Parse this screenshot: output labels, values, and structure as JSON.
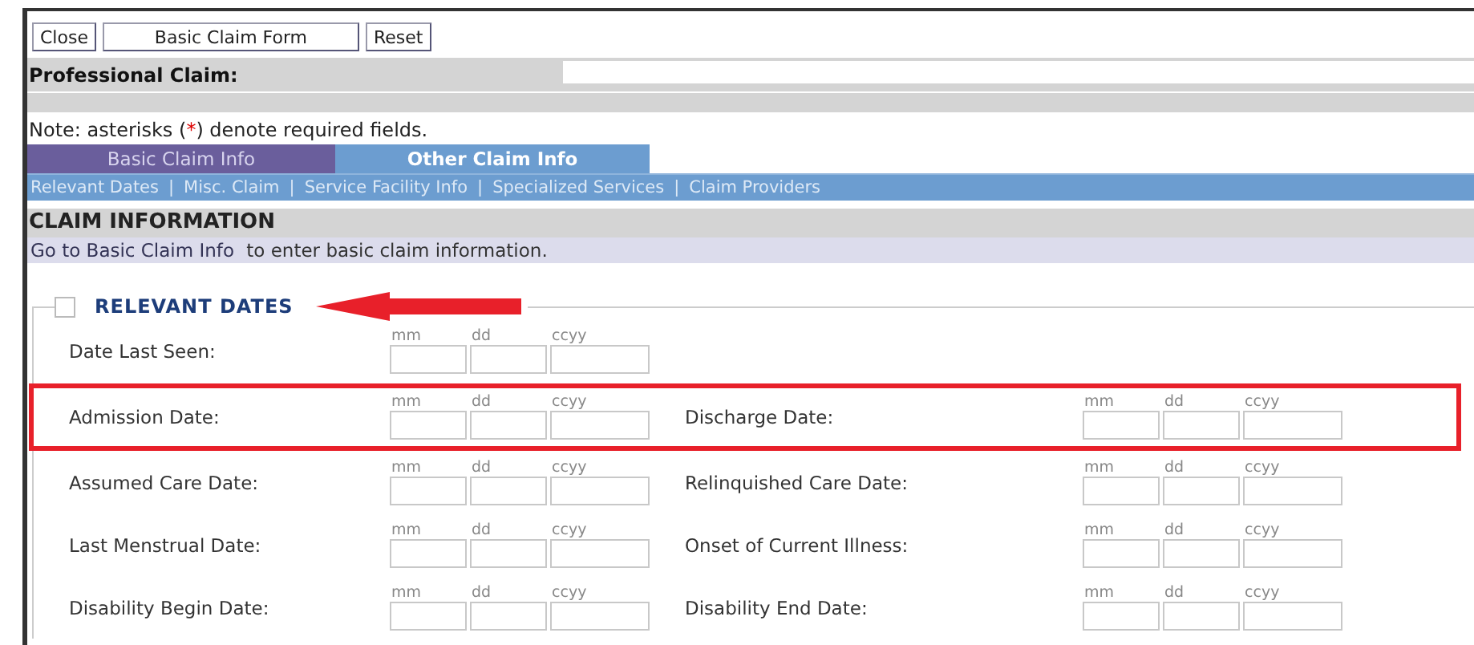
{
  "toolbar": {
    "buttons": [
      "Close",
      "Basic Claim Form",
      "Reset"
    ]
  },
  "header": {
    "title": "Professional Claim:"
  },
  "note": [
    {
      "text": "Note: asterisks (",
      "kind": "plain"
    },
    {
      "text": "*",
      "kind": "required"
    },
    {
      "text": ") denote required fields.",
      "kind": "plain"
    }
  ],
  "tabs": [
    {
      "label": "Basic Claim Info",
      "selected": false
    },
    {
      "label": "Other Claim Info",
      "selected": true
    }
  ],
  "subnav": {
    "separator": "|",
    "links": [
      "Relevant Dates",
      "Misc. Claim",
      "Service Facility Info",
      "Specialized Services",
      "Claim Providers"
    ]
  },
  "section": {
    "title": "CLAIM INFORMATION",
    "link": "Go to Basic Claim Info",
    "text": "to enter basic claim information."
  },
  "fieldset": {
    "title": "RELEVANT DATES",
    "checked": false,
    "pointed": true,
    "rows": [
      {
        "highlighted": false,
        "fields": [
          {
            "label": "Date Last Seen:",
            "hints": [
              "mm",
              "dd",
              "ccyy"
            ]
          }
        ]
      },
      {
        "highlighted": true,
        "fields": [
          {
            "label": "Admission Date:",
            "hints": [
              "mm",
              "dd",
              "ccyy"
            ]
          },
          {
            "label": "Discharge Date:",
            "hints": [
              "mm",
              "dd",
              "ccyy"
            ]
          }
        ]
      },
      {
        "highlighted": false,
        "fields": [
          {
            "label": "Assumed Care Date:",
            "hints": [
              "mm",
              "dd",
              "ccyy"
            ]
          },
          {
            "label": "Relinquished Care Date:",
            "hints": [
              "mm",
              "dd",
              "ccyy"
            ]
          }
        ]
      },
      {
        "highlighted": false,
        "fields": [
          {
            "label": "Last Menstrual Date:",
            "hints": [
              "mm",
              "dd",
              "ccyy"
            ]
          },
          {
            "label": "Onset of Current Illness:",
            "hints": [
              "mm",
              "dd",
              "ccyy"
            ]
          }
        ]
      },
      {
        "highlighted": false,
        "fields": [
          {
            "label": "Disability Begin Date:",
            "hints": [
              "mm",
              "dd",
              "ccyy"
            ]
          },
          {
            "label": "Disability End Date:",
            "hints": [
              "mm",
              "dd",
              "ccyy"
            ]
          }
        ]
      }
    ]
  }
}
